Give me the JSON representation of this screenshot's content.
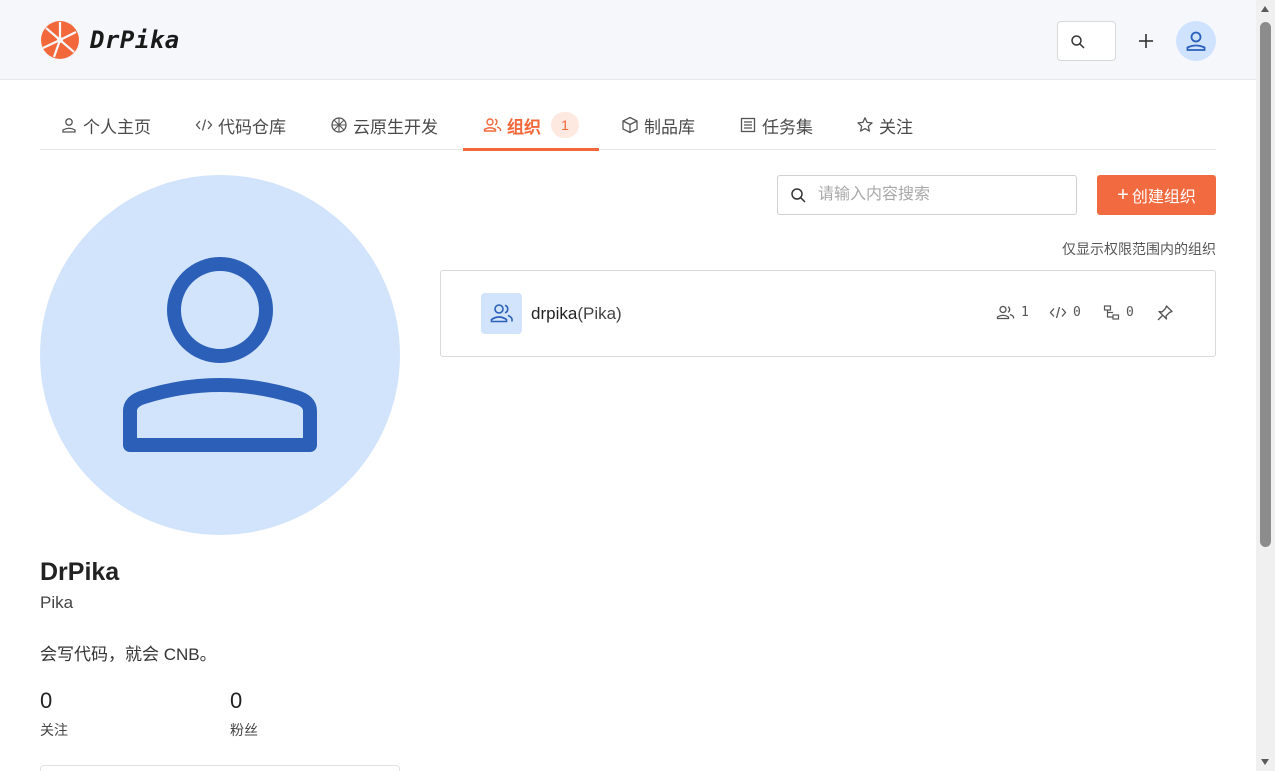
{
  "header": {
    "brand": "DrPika",
    "logo_icon": "fan-logo-icon",
    "search_icon": "search-icon",
    "add_icon": "plus-icon",
    "avatar_icon": "user-icon"
  },
  "tabs": [
    {
      "label": "个人主页",
      "icon": "user-icon"
    },
    {
      "label": "代码仓库",
      "icon": "code-icon"
    },
    {
      "label": "云原生开发",
      "icon": "cloud-native-icon"
    },
    {
      "label": "组织",
      "icon": "users-icon",
      "badge": "1",
      "active": true
    },
    {
      "label": "制品库",
      "icon": "package-icon"
    },
    {
      "label": "任务集",
      "icon": "list-icon"
    },
    {
      "label": "关注",
      "icon": "star-icon"
    }
  ],
  "profile": {
    "name": "DrPika",
    "handle": "Pika",
    "bio": "会写代码，就会 CNB。",
    "following_count": "0",
    "following_label": "关注",
    "followers_count": "0",
    "followers_label": "粉丝"
  },
  "org_panel": {
    "search_placeholder": "请输入内容搜索",
    "create_label": "创建组织",
    "scope_note": "仅显示权限范围内的组织",
    "orgs": [
      {
        "name": "drpika",
        "alias": "(Pika)",
        "members": "1",
        "repos": "0",
        "sub_orgs": "0"
      }
    ]
  },
  "colors": {
    "accent": "#f2683a",
    "avatar_bg": "#d2e4fb",
    "avatar_fg": "#2b5fb8"
  }
}
